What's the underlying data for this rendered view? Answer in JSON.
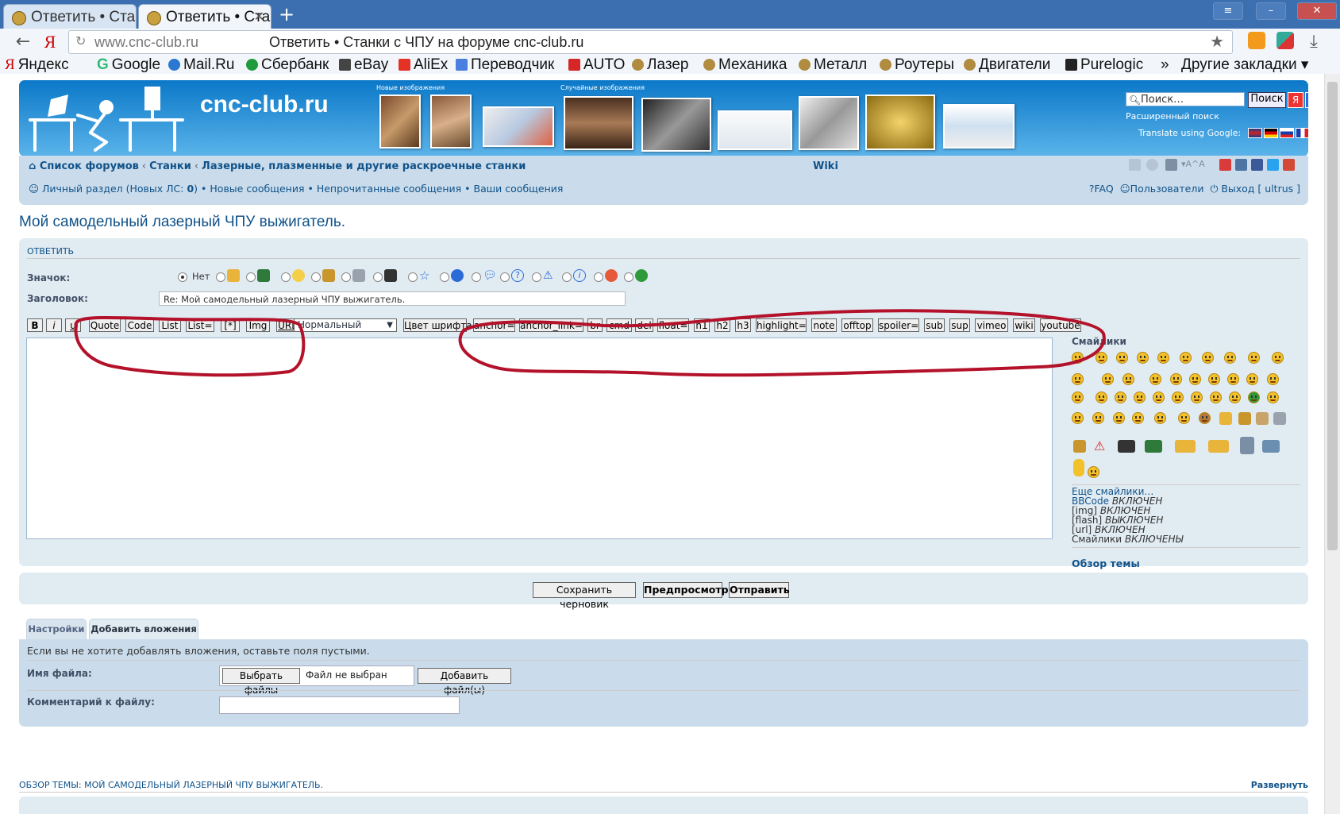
{
  "browser": {
    "tabs": [
      {
        "label": "Ответить • Ста",
        "active": false
      },
      {
        "label": "Ответить • Ста",
        "active": true
      }
    ],
    "new_tab": "+",
    "url_host": "www.cnc-club.ru",
    "url_title": "Ответить • Станки с ЧПУ на форуме cnc-club.ru",
    "bookmarks": [
      "Яндекс",
      "Google",
      "Mail.Ru",
      "Сбербанк",
      "eBay",
      "AliEx",
      "Переводчик",
      "AUTO",
      "Лазер",
      "Механика",
      "Металл",
      "Роутеры",
      "Двигатели",
      "Purelogic"
    ],
    "bookmarks_more": "»",
    "other_bookmarks": "Другие закладки"
  },
  "header": {
    "logo": "cnc-club.ru",
    "new_images": "Новые изображения",
    "random_images": "Случайные изображения",
    "search_placeholder": "Поиск…",
    "search_button": "Поиск",
    "advanced_search": "Расширенный поиск",
    "translate": "Translate using Google:"
  },
  "nav": {
    "forums": "Список форумов",
    "crumb2": "Станки",
    "crumb3": "Лазерные, плазменные и другие раскроечные станки",
    "wiki": "Wiki",
    "personal": "Личный раздел (Новых ЛС:",
    "personal_count": "0",
    "personal_close": ")",
    "links": [
      "Новые сообщения",
      "Непрочитанные сообщения",
      "Ваши сообщения"
    ],
    "faq": "FAQ",
    "users": "Пользователи",
    "logout": "Выход [ ultrus ]"
  },
  "page_title": "Мой самодельный лазерный ЧПУ выжигатель.",
  "post": {
    "section": "Ответить",
    "icon_label": "Значок:",
    "icon_none": "Нет",
    "subject_label": "Заголовок:",
    "subject_value": "Re: Мой самодельный лазерный ЧПУ выжигатель.",
    "bbcodes_left": [
      "B",
      "i",
      "u",
      "Quote",
      "Code",
      "List",
      "List=",
      "[*]",
      "Img",
      "URL"
    ],
    "font_size": "Нормальный",
    "font_color": "Цвет шрифта",
    "bbcodes_right": [
      "anchor=",
      "anchor_link=",
      "br",
      "cmd",
      "del",
      "float=",
      "h1",
      "h2",
      "h3",
      "highlight=",
      "note",
      "offtop",
      "spoiler=",
      "sub",
      "sup",
      "vimeo",
      "wiki",
      "youtube"
    ],
    "smilies_title": "Смайлики",
    "more_smilies": "Еще смайлики…",
    "options": [
      {
        "name": "BBCode",
        "state": "ВКЛЮЧЕН"
      },
      {
        "name": "[img]",
        "state": "ВКЛЮЧЕН"
      },
      {
        "name": "[flash]",
        "state": "ВЫКЛЮЧЕН"
      },
      {
        "name": "[url]",
        "state": "ВКЛЮЧЕН"
      },
      {
        "name": "Смайлики",
        "state": "ВКЛЮЧЕНЫ"
      }
    ],
    "topic_review": "Обзор темы"
  },
  "submit": {
    "save_draft": "Сохранить черновик",
    "preview": "Предпросмотр",
    "send": "Отправить"
  },
  "tabs": {
    "settings": "Настройки",
    "attachments": "Добавить вложения"
  },
  "attach": {
    "hint": "Если вы не хотите добавлять вложения, оставьте поля пустыми.",
    "filename_label": "Имя файла:",
    "choose_files": "Выбрать файлы",
    "no_file": "Файл не выбран",
    "add_files": "Добавить файл(ы)",
    "comment_label": "Комментарий к файлу:"
  },
  "review": {
    "header": "Обзор темы: Мой самодельный лазерный ЧПУ выжигатель.",
    "expand": "Развернуть"
  },
  "colors": {
    "annotation": "#b3122a",
    "link": "#105289",
    "panel": "#e1ebf2",
    "nav": "#cadceb"
  }
}
